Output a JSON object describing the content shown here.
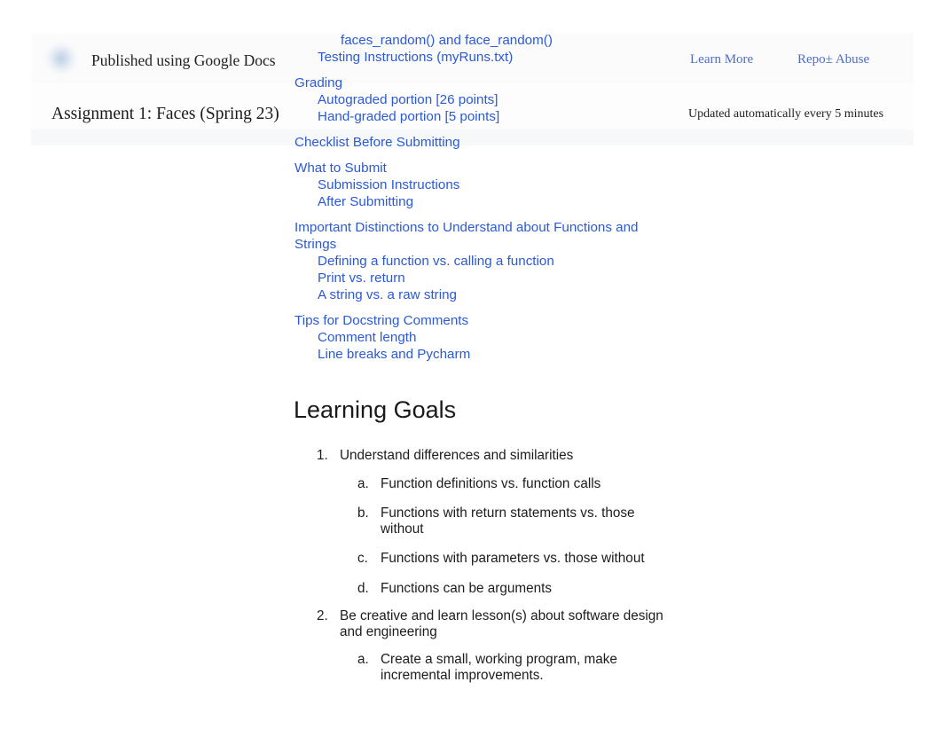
{
  "published_header": {
    "logo_icon": "google-docs-logo-icon",
    "published_label": "Published using Google Docs",
    "learn_more_label": "Learn More",
    "report_abuse_label": "Repo± Abuse",
    "doc_title": "Assignment 1: Faces (Spring 23)",
    "update_note": "Updated automatically every 5 minutes",
    "link_color": "#4d6fc4"
  },
  "toc": {
    "link_color": "#2b5ad6",
    "items": [
      {
        "label": "faces_random() and face_random()",
        "level": 3,
        "gap_after": false
      },
      {
        "label": "Testing Instructions (myRuns.txt)",
        "level": 2,
        "gap_after": true
      },
      {
        "label": "Grading",
        "level": 1,
        "gap_after": false
      },
      {
        "label": "Autograded portion [26 points]",
        "level": 2,
        "gap_after": false
      },
      {
        "label": "Hand-graded portion [5 points]",
        "level": 2,
        "gap_after": true
      },
      {
        "label": "Checklist Before Submitting",
        "level": 1,
        "gap_after": true
      },
      {
        "label": "What to Submit",
        "level": 1,
        "gap_after": false
      },
      {
        "label": "Submission Instructions",
        "level": 2,
        "gap_after": false
      },
      {
        "label": "After Submitting",
        "level": 2,
        "gap_after": true
      },
      {
        "label": "Important Distinctions to Understand about Functions and Strings",
        "level": 1,
        "gap_after": false
      },
      {
        "label": "Defining a function vs. calling a function",
        "level": 2,
        "gap_after": false
      },
      {
        "label": "Print vs. return",
        "level": 2,
        "gap_after": false
      },
      {
        "label": "A string vs. a raw string",
        "level": 2,
        "gap_after": true
      },
      {
        "label": "Tips for Docstring Comments",
        "level": 1,
        "gap_after": false
      },
      {
        "label": "Comment length",
        "level": 2,
        "gap_after": false
      },
      {
        "label": "Line breaks and Pycharm",
        "level": 2,
        "gap_after": false
      }
    ]
  },
  "content": {
    "heading": "Learning Goals",
    "goals": [
      {
        "marker": "1.",
        "text": "Understand differences and similarities",
        "sub": [
          {
            "marker": "a.",
            "text": "Function definitions vs. function calls"
          },
          {
            "marker": "b.",
            "text": "Functions with return statements vs. those without"
          },
          {
            "marker": "c.",
            "text": "Functions with parameters vs. those without"
          },
          {
            "marker": "d.",
            "text": "Functions can be arguments"
          }
        ]
      },
      {
        "marker": "2.",
        "text": "Be creative and learn lesson(s) about software design and engineering",
        "sub": [
          {
            "marker": "a.",
            "text": "Create a small, working program, make incremental improvements."
          }
        ]
      }
    ]
  }
}
